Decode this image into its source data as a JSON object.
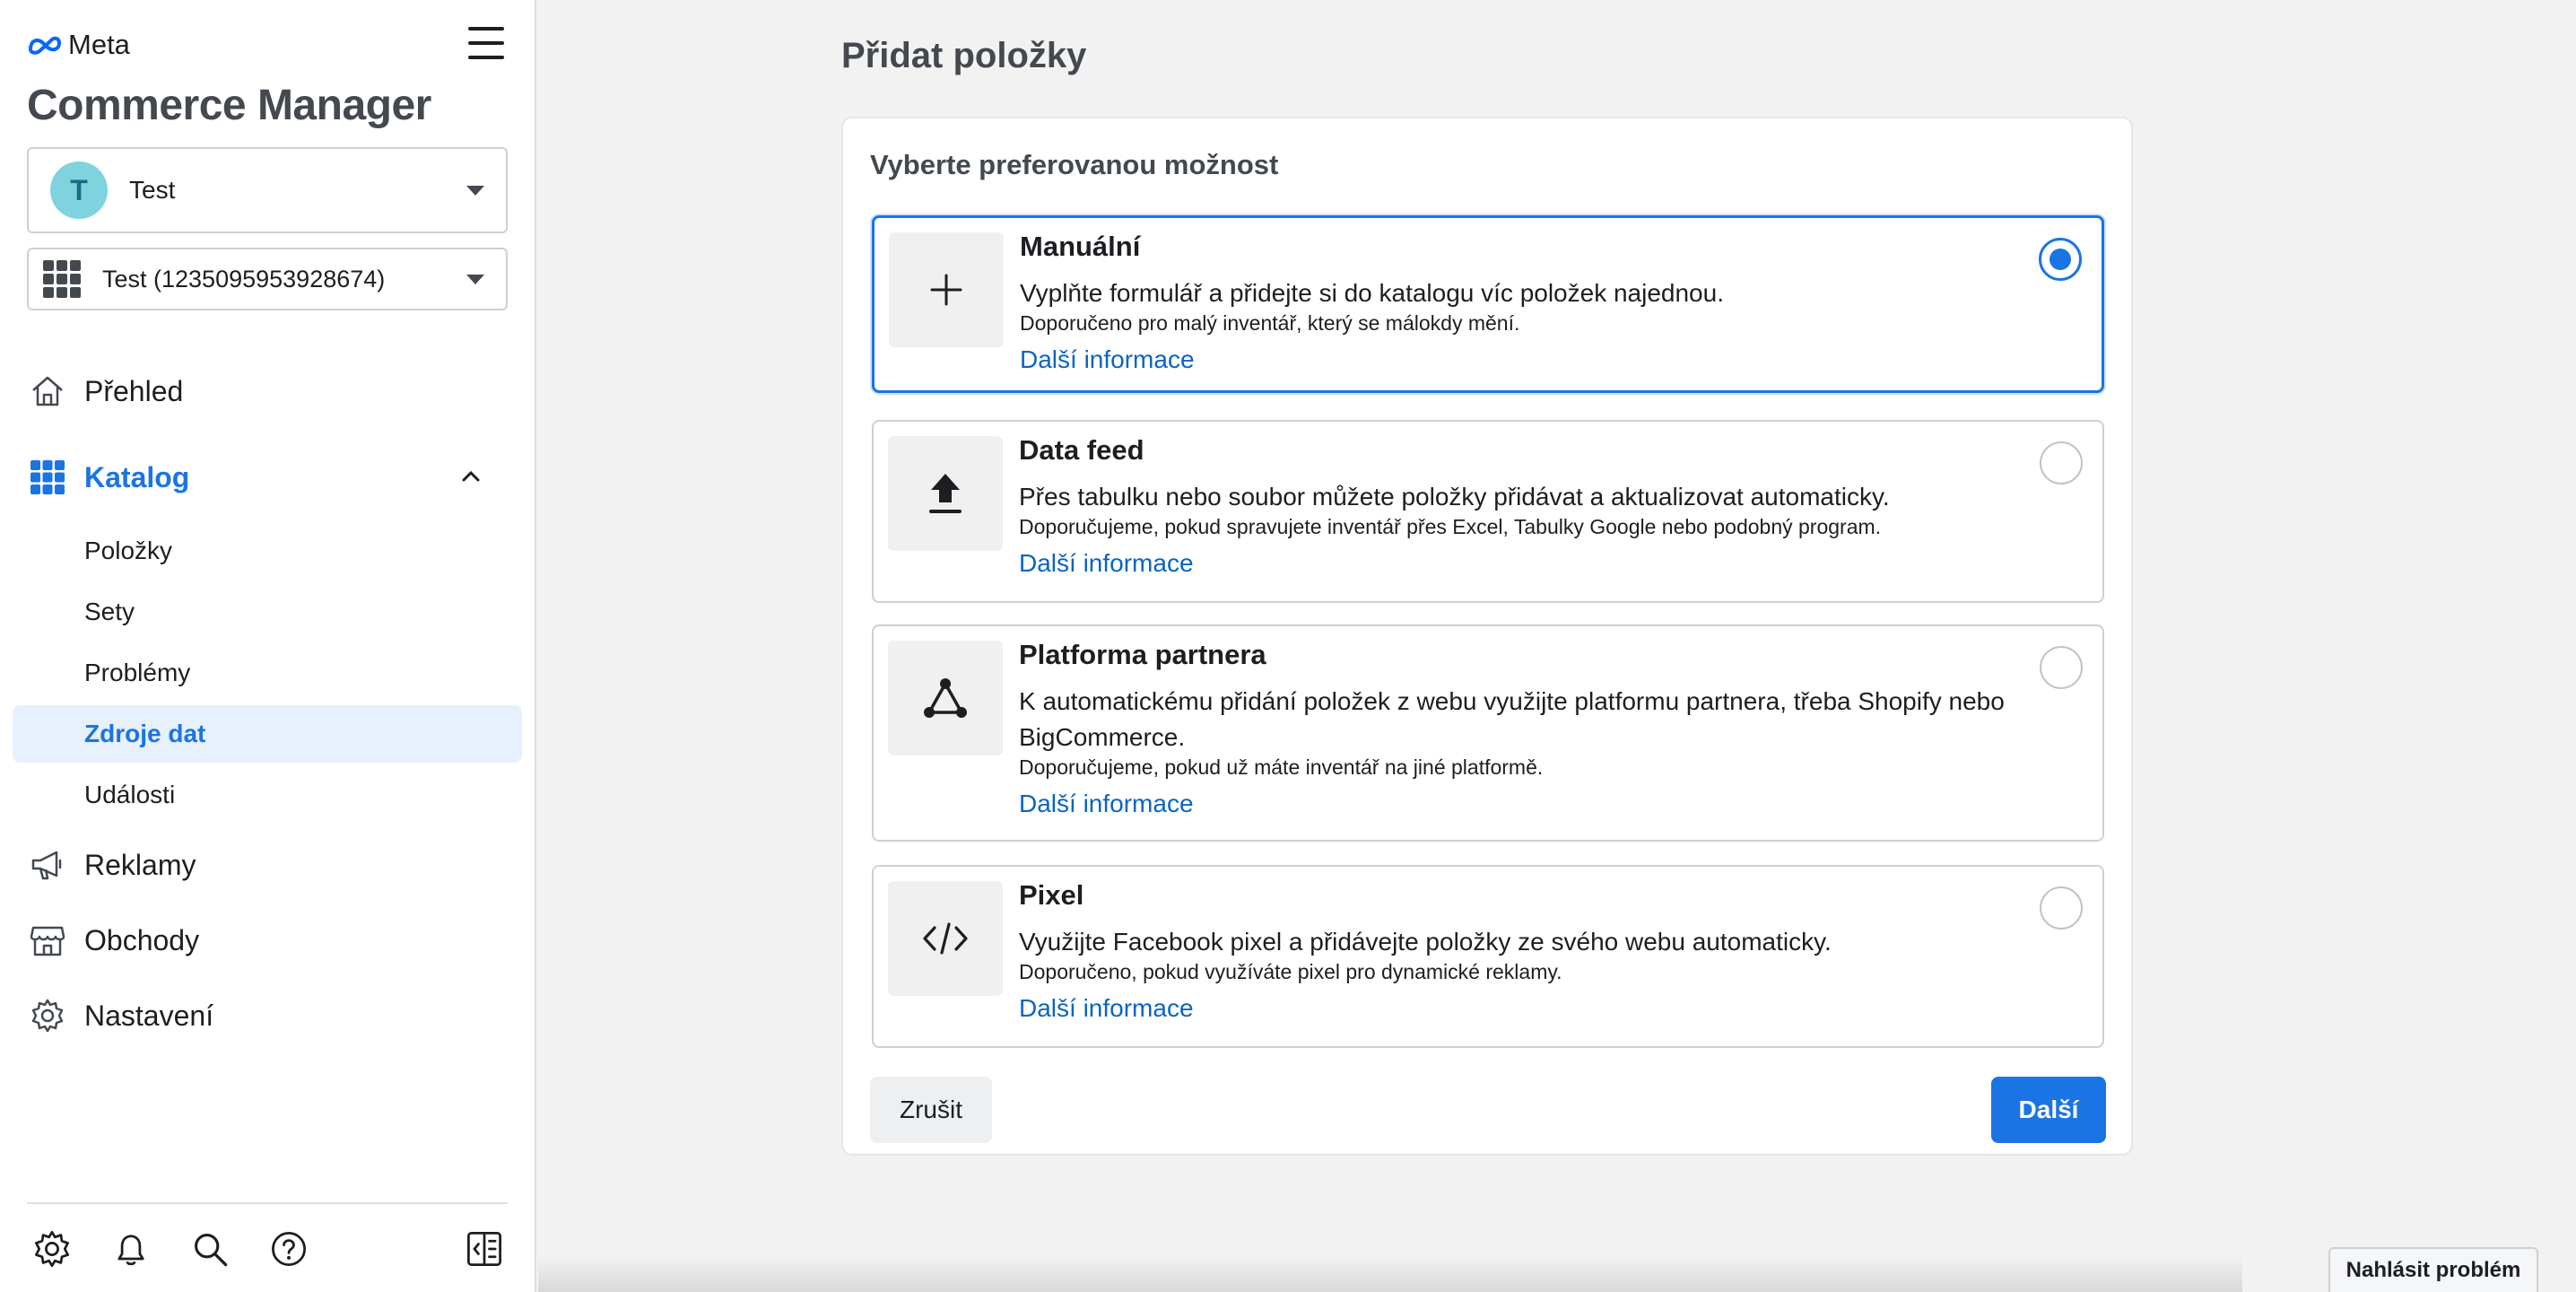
{
  "brand": {
    "logo_text": "Meta"
  },
  "app": {
    "title": "Commerce Manager"
  },
  "account": {
    "avatar_letter": "T",
    "name": "Test"
  },
  "catalog": {
    "name": "Test (1235095953928674)"
  },
  "nav": {
    "overview": "Přehled",
    "catalog": "Katalog",
    "catalog_sub": [
      "Položky",
      "Sety",
      "Problémy",
      "Zdroje dat",
      "Události"
    ],
    "ads": "Reklamy",
    "shops": "Obchody",
    "settings": "Nastavení"
  },
  "page": {
    "title": "Přidat položky"
  },
  "card": {
    "heading": "Vyberte preferovanou možnost",
    "options": [
      {
        "title": "Manuální",
        "desc": "Vyplňte formulář a přidejte si do katalogu víc položek najednou.",
        "rec": "Doporučeno pro malý inventář, který se málokdy mění.",
        "more": "Další informace",
        "icon": "plus-icon",
        "selected": true
      },
      {
        "title": "Data feed",
        "desc": "Přes tabulku nebo soubor můžete položky přidávat a aktualizovat automaticky.",
        "rec": "Doporučujeme, pokud spravujete inventář přes Excel, Tabulky Google nebo podobný program.",
        "more": "Další informace",
        "icon": "upload-icon",
        "selected": false
      },
      {
        "title": "Platforma partnera",
        "desc": "K automatickému přidání položek z webu využijte platformu partnera, třeba Shopify nebo BigCommerce.",
        "rec": "Doporučujeme, pokud už máte inventář na jiné platformě.",
        "more": "Další informace",
        "icon": "network-icon",
        "selected": false
      },
      {
        "title": "Pixel",
        "desc": "Využijte Facebook pixel a přidávejte položky ze svého webu automaticky.",
        "rec": "Doporučeno, pokud využíváte pixel pro dynamické reklamy.",
        "more": "Další informace",
        "icon": "code-icon",
        "selected": false
      }
    ],
    "cancel_label": "Zrušit",
    "next_label": "Další"
  },
  "report": {
    "label": "Nahlásit problém"
  },
  "colors": {
    "accent": "#1b74e4",
    "link": "#0a64c2",
    "selected_bg": "#e7f0fd"
  }
}
